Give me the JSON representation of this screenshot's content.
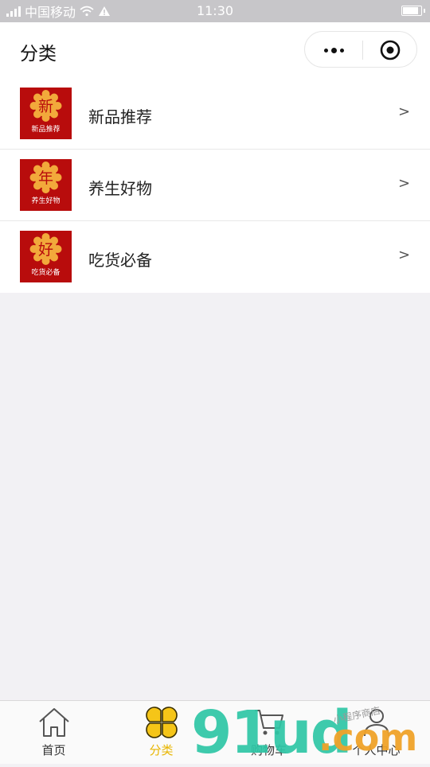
{
  "status_bar": {
    "carrier": "中国移动",
    "time": "11:30",
    "battery_level": 0.95
  },
  "nav": {
    "title": "分类"
  },
  "categories": [
    {
      "name": "新品推荐",
      "badge_char": "新",
      "badge_caption": "新品推荐",
      "arrow": ">"
    },
    {
      "name": "养生好物",
      "badge_char": "年",
      "badge_caption": "养生好物",
      "arrow": ">"
    },
    {
      "name": "吃货必备",
      "badge_char": "好",
      "badge_caption": "吃货必备",
      "arrow": ">"
    }
  ],
  "tab_bar": {
    "items": [
      {
        "label": "首页",
        "icon": "home-icon",
        "active": false
      },
      {
        "label": "分类",
        "icon": "category-icon",
        "active": true
      },
      {
        "label": "购物车",
        "icon": "cart-icon",
        "active": false
      },
      {
        "label": "个人中心",
        "icon": "user-icon",
        "active": false
      }
    ]
  },
  "watermark": {
    "main": "91ud",
    "suffix": ".com",
    "handwritten": "小程序商店"
  },
  "colors": {
    "accent": "#e8b500",
    "badge_red": "#b80c0c",
    "badge_gold": "#f2a93b",
    "status_bar": "#c7c6c9",
    "background": "#f2f1f4"
  }
}
